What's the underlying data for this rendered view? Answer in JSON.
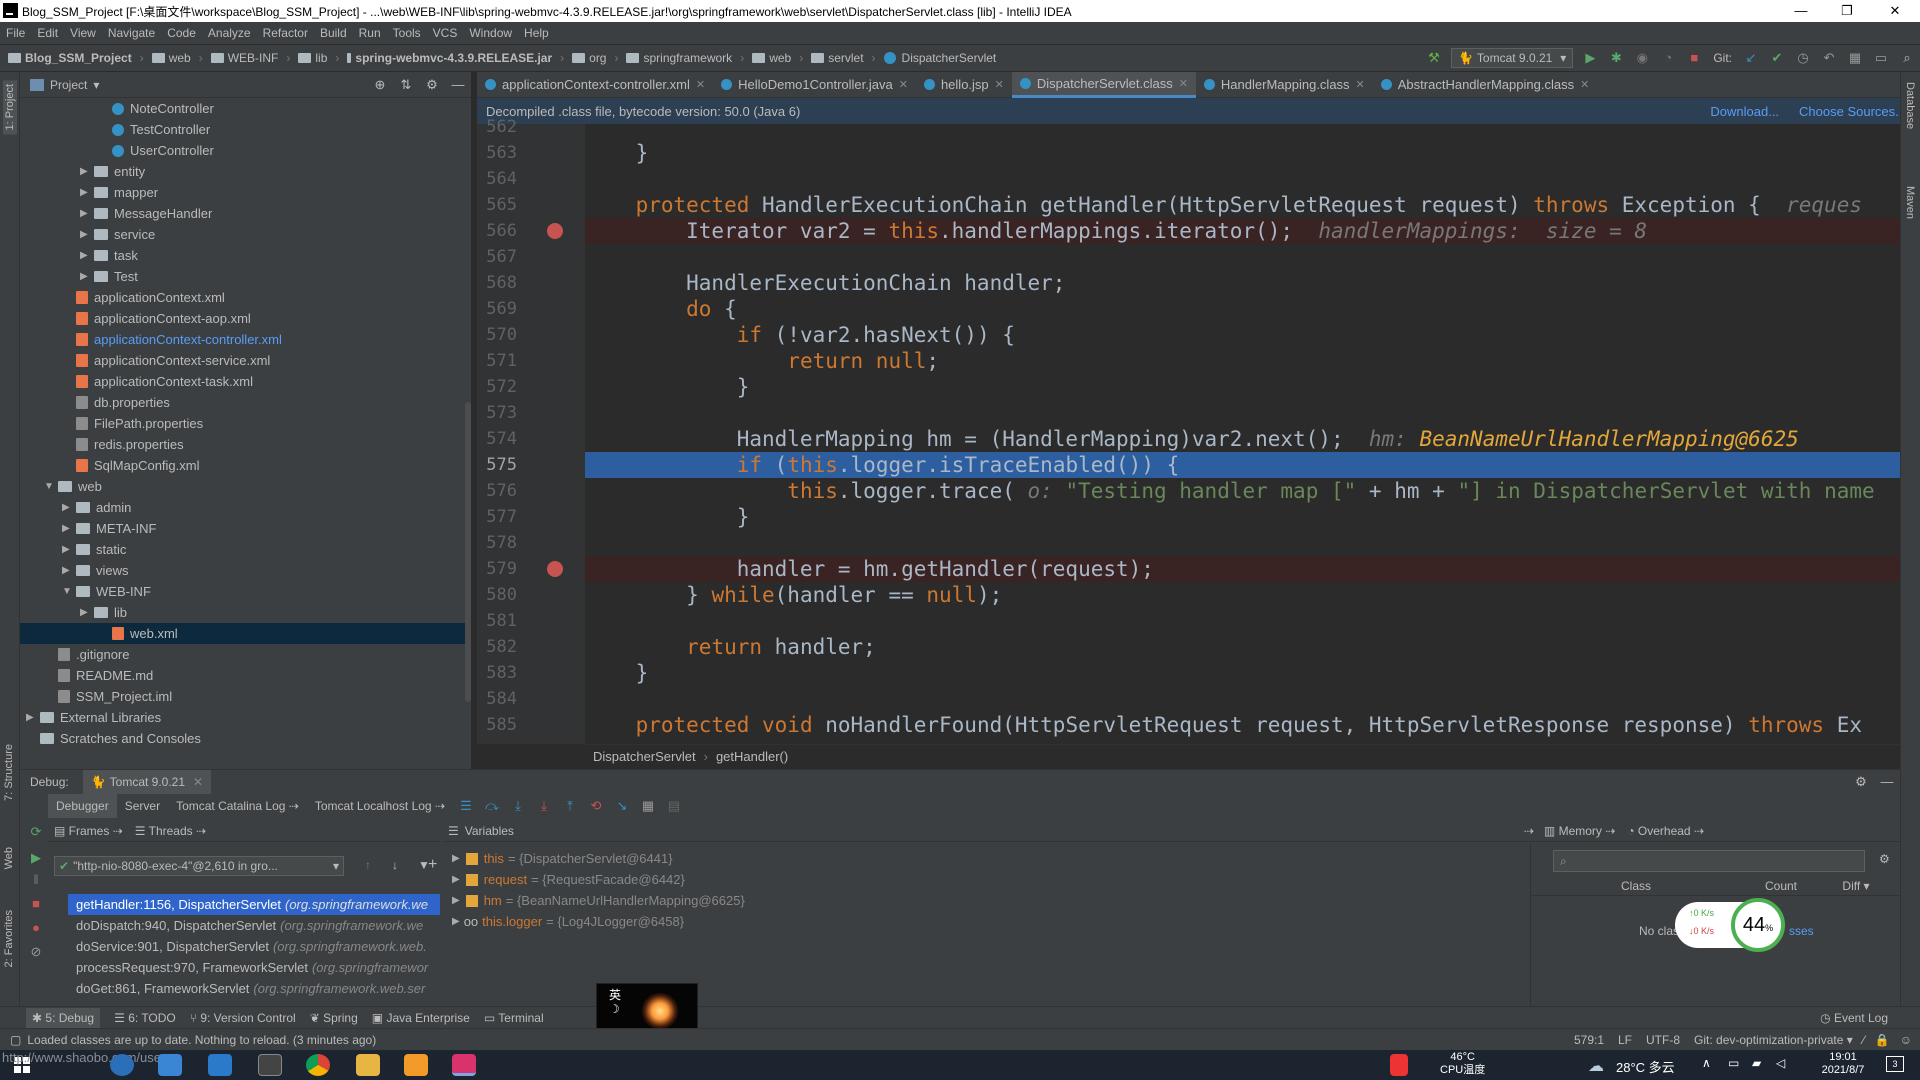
{
  "window": {
    "title": "Blog_SSM_Project [F:\\桌面文件\\workspace\\Blog_SSM_Project] - ...\\web\\WEB-INF\\lib\\spring-webmvc-4.3.9.RELEASE.jar!\\org\\springframework\\web\\servlet\\DispatcherServlet.class [lib] - IntelliJ IDEA",
    "min": "—",
    "max": "❐",
    "close": "✕"
  },
  "menu": [
    "File",
    "Edit",
    "View",
    "Navigate",
    "Code",
    "Analyze",
    "Refactor",
    "Build",
    "Run",
    "Tools",
    "VCS",
    "Window",
    "Help"
  ],
  "breadcrumbs": [
    "Blog_SSM_Project",
    "web",
    "WEB-INF",
    "lib",
    "spring-webmvc-4.3.9.RELEASE.jar",
    "org",
    "springframework",
    "web",
    "servlet",
    "DispatcherServlet"
  ],
  "run_config": "Tomcat 9.0.21",
  "git_label": "Git:",
  "project_panel": {
    "title": "Project",
    "items": [
      {
        "label": "NoteController",
        "type": "class",
        "indent": 4
      },
      {
        "label": "TestController",
        "type": "class",
        "indent": 4
      },
      {
        "label": "UserController",
        "type": "class",
        "indent": 4
      },
      {
        "label": "entity",
        "type": "folder",
        "indent": 3,
        "arrow": "▶"
      },
      {
        "label": "mapper",
        "type": "folder",
        "indent": 3,
        "arrow": "▶"
      },
      {
        "label": "MessageHandler",
        "type": "folder",
        "indent": 3,
        "arrow": "▶"
      },
      {
        "label": "service",
        "type": "folder",
        "indent": 3,
        "arrow": "▶"
      },
      {
        "label": "task",
        "type": "folder",
        "indent": 3,
        "arrow": "▶"
      },
      {
        "label": "Test",
        "type": "folder",
        "indent": 3,
        "arrow": "▶"
      },
      {
        "label": "applicationContext.xml",
        "type": "xml",
        "indent": 2
      },
      {
        "label": "applicationContext-aop.xml",
        "type": "xml",
        "indent": 2
      },
      {
        "label": "applicationContext-controller.xml",
        "type": "xml",
        "indent": 2,
        "highlight": true
      },
      {
        "label": "applicationContext-service.xml",
        "type": "xml",
        "indent": 2
      },
      {
        "label": "applicationContext-task.xml",
        "type": "xml",
        "indent": 2
      },
      {
        "label": "db.properties",
        "type": "prop",
        "indent": 2
      },
      {
        "label": "FilePath.properties",
        "type": "prop",
        "indent": 2
      },
      {
        "label": "redis.properties",
        "type": "prop",
        "indent": 2
      },
      {
        "label": "SqlMapConfig.xml",
        "type": "xml",
        "indent": 2
      },
      {
        "label": "web",
        "type": "folder",
        "indent": 1,
        "arrow": "▼"
      },
      {
        "label": "admin",
        "type": "folder",
        "indent": 2,
        "arrow": "▶"
      },
      {
        "label": "META-INF",
        "type": "folder",
        "indent": 2,
        "arrow": "▶"
      },
      {
        "label": "static",
        "type": "folder",
        "indent": 2,
        "arrow": "▶"
      },
      {
        "label": "views",
        "type": "folder",
        "indent": 2,
        "arrow": "▶"
      },
      {
        "label": "WEB-INF",
        "type": "folder",
        "indent": 2,
        "arrow": "▼"
      },
      {
        "label": "lib",
        "type": "folder",
        "indent": 3,
        "arrow": "▶"
      },
      {
        "label": "web.xml",
        "type": "xml",
        "indent": 4,
        "selected": true
      },
      {
        "label": ".gitignore",
        "type": "prop",
        "indent": 1
      },
      {
        "label": "README.md",
        "type": "prop",
        "indent": 1
      },
      {
        "label": "SSM_Project.iml",
        "type": "prop",
        "indent": 1
      },
      {
        "label": "External Libraries",
        "type": "folder",
        "indent": 0,
        "arrow": "▶"
      },
      {
        "label": "Scratches and Consoles",
        "type": "folder",
        "indent": 0
      }
    ]
  },
  "editor_tabs": [
    {
      "label": "applicationContext-controller.xml"
    },
    {
      "label": "HelloDemo1Controller.java"
    },
    {
      "label": "hello.jsp"
    },
    {
      "label": "DispatcherServlet.class",
      "active": true
    },
    {
      "label": "HandlerMapping.class"
    },
    {
      "label": "AbstractHandlerMapping.class"
    }
  ],
  "decompiled_banner": {
    "text": "Decompiled .class file, bytecode version: 50.0 (Java 6)",
    "download": "Download...",
    "choose": "Choose Sources..."
  },
  "code_lines": [
    {
      "n": "562",
      "html": ""
    },
    {
      "n": "563",
      "html": "    }"
    },
    {
      "n": "564",
      "html": ""
    },
    {
      "n": "565",
      "html": "    <span class=\"kw\">protected</span> HandlerExecutionChain getHandler(HttpServletRequest request) <span class=\"kw\">throws</span> Exception {  <span class=\"hint\">reques</span>"
    },
    {
      "n": "566",
      "html": "        Iterator var2 = <span class=\"kw\">this</span>.handlerMappings.iterator();  <span class=\"hint\">handlerMappings:  size = 8</span>",
      "bp": true
    },
    {
      "n": "567",
      "html": ""
    },
    {
      "n": "568",
      "html": "        HandlerExecutionChain handler;"
    },
    {
      "n": "569",
      "html": "        <span class=\"kw\">do</span> {"
    },
    {
      "n": "570",
      "html": "            <span class=\"kw\">if</span> (!var2.hasNext()) {"
    },
    {
      "n": "571",
      "html": "                <span class=\"kw\">return null</span>;"
    },
    {
      "n": "572",
      "html": "            }"
    },
    {
      "n": "573",
      "html": ""
    },
    {
      "n": "574",
      "html": "            HandlerMapping hm = (HandlerMapping)var2.next();  <span class=\"hint\">hm: </span><span class=\"hint2\">BeanNameUrlHandlerMapping@6625</span>"
    },
    {
      "n": "575",
      "html": "            <span class=\"kw\">if</span> (<span class=\"kw\">this</span>.logger.isTraceEnabled()) {",
      "cur": true
    },
    {
      "n": "576",
      "html": "                <span class=\"kw\">this</span>.logger.trace( <span class=\"hint\">o:</span> <span class=\"str\">\"Testing handler map [\"</span> + hm + <span class=\"str\">\"] in DispatcherServlet with name</span>"
    },
    {
      "n": "577",
      "html": "            }"
    },
    {
      "n": "578",
      "html": ""
    },
    {
      "n": "579",
      "html": "            handler = hm.getHandler(request);",
      "bp": true
    },
    {
      "n": "580",
      "html": "        } <span class=\"kw\">while</span>(handler == <span class=\"kw\">null</span>);"
    },
    {
      "n": "581",
      "html": ""
    },
    {
      "n": "582",
      "html": "        <span class=\"kw\">return</span> handler;"
    },
    {
      "n": "583",
      "html": "    }"
    },
    {
      "n": "584",
      "html": ""
    },
    {
      "n": "585",
      "html": "    <span class=\"kw\">protected void</span> noHandlerFound(HttpServletRequest request, HttpServletResponse response) <span class=\"kw\">throws</span> Ex"
    }
  ],
  "editor_breadcrumb": [
    "DispatcherServlet",
    "getHandler()"
  ],
  "debug": {
    "title": "Debug:",
    "session": "Tomcat 9.0.21",
    "tabs": [
      "Debugger",
      "Server",
      "Tomcat Catalina Log",
      "Tomcat Localhost Log"
    ],
    "frames_label": "Frames",
    "threads_label": "Threads",
    "variables_label": "Variables",
    "thread": "\"http-nio-8080-exec-4\"@2,610 in gro...",
    "frames": [
      {
        "m": "getHandler:1156, DispatcherServlet",
        "p": "(org.springframework.we",
        "sel": true
      },
      {
        "m": "doDispatch:940, DispatcherServlet",
        "p": "(org.springframework.we"
      },
      {
        "m": "doService:901, DispatcherServlet",
        "p": "(org.springframework.web."
      },
      {
        "m": "processRequest:970, FrameworkServlet",
        "p": "(org.springframewor"
      },
      {
        "m": "doGet:861, FrameworkServlet",
        "p": "(org.springframework.web.ser"
      }
    ],
    "variables": [
      {
        "name": "this",
        "value": "= {DispatcherServlet@6441}"
      },
      {
        "name": "request",
        "value": "= {RequestFacade@6442}"
      },
      {
        "name": "hm",
        "value": "= {BeanNameUrlHandlerMapping@6625}"
      },
      {
        "name": "this.logger",
        "value": "= {Log4JLogger@6458}",
        "oo": "oo"
      }
    ],
    "memory_label": "Memory",
    "overhead_label": "Overhead",
    "cols": [
      "Class",
      "Count",
      "Diff"
    ],
    "no_classes": "No classes",
    "no_classes_tail": "sses",
    "cpu_widget": {
      "up": "0 K/s",
      "down": "0 K/s",
      "percent": "44",
      "suffix": "%"
    }
  },
  "toolwindows": [
    "5: Debug",
    "6: TODO",
    "9: Version Control",
    "Spring",
    "Java Enterprise",
    "Terminal"
  ],
  "event_log": "Event Log",
  "status": {
    "message": "Loaded classes are up to date. Nothing to reload. (3 minutes ago)",
    "position": "579:1",
    "lf": "LF",
    "encoding": "UTF-8",
    "git": "Git: dev-optimization-private"
  },
  "taskbar": {
    "watermark": "http://www.shaobo.com/users",
    "temp": "46°C",
    "temp_label": "CPU温度",
    "weather": "28°C 多云",
    "time": "19:01",
    "date": "2021/8/7",
    "notif": "3"
  },
  "ime": {
    "label": "英",
    "moon": "☽"
  },
  "left_stripe": [
    "1: Project",
    "7: Structure",
    "Web",
    "2: Favorites"
  ],
  "right_stripe": [
    "Database",
    "Maven"
  ]
}
